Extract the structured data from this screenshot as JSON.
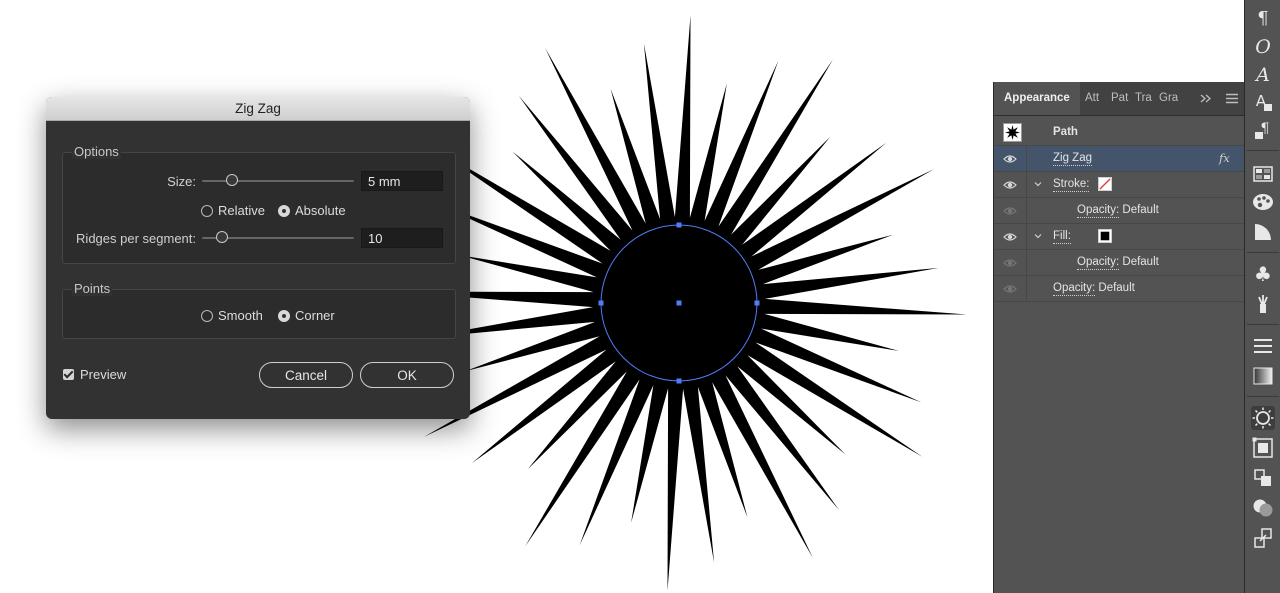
{
  "dialog": {
    "title": "Zig Zag",
    "options_group": "Options",
    "size_label": "Size:",
    "size_value": "5 mm",
    "size_slider_fraction": 0.17,
    "mode_relative": "Relative",
    "mode_absolute": "Absolute",
    "mode_selected": "Absolute",
    "ridges_label": "Ridges per segment:",
    "ridges_value": "10",
    "ridges_slider_fraction": 0.1,
    "points_group": "Points",
    "points_smooth": "Smooth",
    "points_corner": "Corner",
    "points_selected": "Corner",
    "preview_label": "Preview",
    "preview_checked": true,
    "cancel_label": "Cancel",
    "ok_label": "OK"
  },
  "canvas": {
    "shape": "circle with zig-zag spikes",
    "fill_color": "#000000",
    "selection_color": "#4f7df7"
  },
  "appearance_panel": {
    "tabs": [
      "Appearance",
      "Att",
      "Pat",
      "Tra",
      "Gra"
    ],
    "active_tab": "Appearance",
    "overflow_icon": "double-chevron-icon",
    "menu_icon": "hamburger-icon",
    "header": "Path",
    "effect": "Zig Zag",
    "fx_label": "fx",
    "stroke_label": "Stroke:",
    "stroke_opacity": "Opacity:",
    "stroke_opacity_value": "Default",
    "fill_label": "Fill:",
    "fill_opacity": "Opacity:",
    "fill_opacity_value": "Default",
    "object_opacity": "Opacity:",
    "object_opacity_value": "Default",
    "selection_color": "#44546a"
  },
  "tool_strip": {
    "icons": [
      "pilcrow-icon",
      "opentype-o-icon",
      "glyphs-a-icon",
      "character-styles-icon",
      "paragraph-styles-icon",
      "swatches-icon",
      "color-palette-icon",
      "color-guide-icon",
      "symbols-club-icon",
      "brushes-icon",
      "stroke-lines-icon",
      "gradient-icon",
      "appearance-sun-icon",
      "transform-icon",
      "align-icon",
      "pathfinder-icon",
      "links-icon"
    ]
  }
}
